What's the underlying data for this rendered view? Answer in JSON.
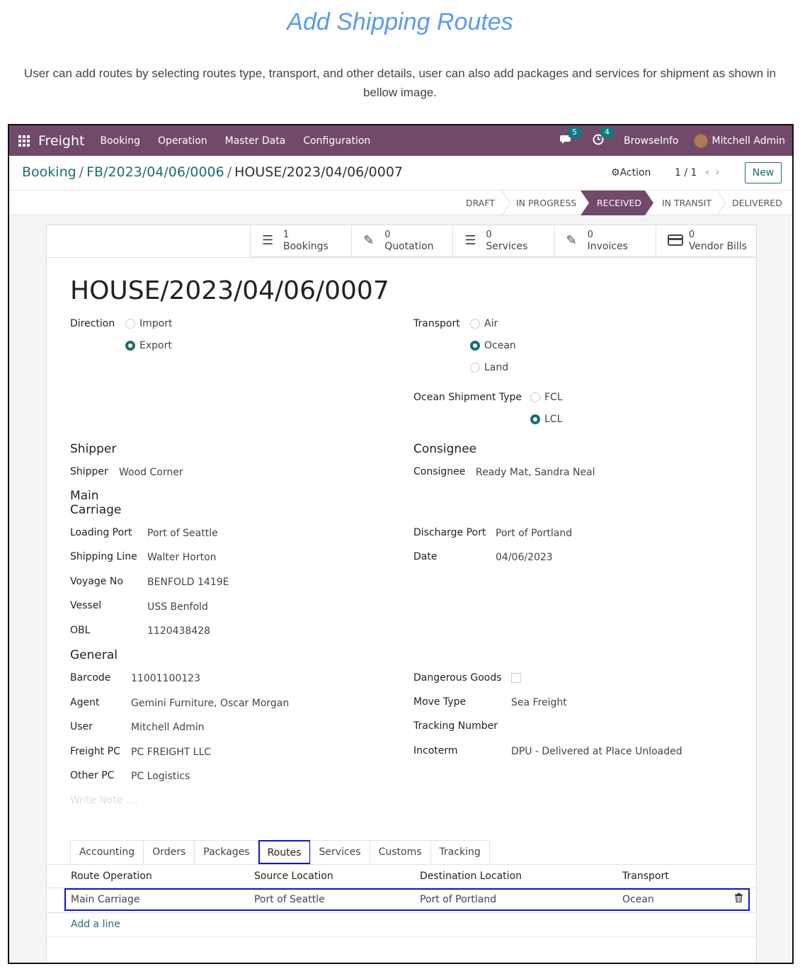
{
  "doc": {
    "title": "Add Shipping Routes",
    "intro": "User can add routes by selecting routes type, transport, and other details, user can also add packages and services for shipment as shown in bellow image."
  },
  "navbar": {
    "brand": "Freight",
    "menus": [
      "Booking",
      "Operation",
      "Master Data",
      "Configuration"
    ],
    "messages_count": "5",
    "activities_count": "4",
    "company": "BrowseInfo",
    "user": "Mitchell Admin"
  },
  "breadcrumb": [
    "Booking",
    "FB/2023/04/06/0006",
    "HOUSE/2023/04/06/0007"
  ],
  "control": {
    "action": "Action",
    "pager": "1 / 1",
    "new": "New"
  },
  "stages": [
    {
      "label": "DRAFT",
      "active": false
    },
    {
      "label": "IN PROGRESS",
      "active": false
    },
    {
      "label": "RECEIVED",
      "active": true
    },
    {
      "label": "IN TRANSIT",
      "active": false
    },
    {
      "label": "DELIVERED",
      "active": false
    }
  ],
  "smart_buttons": [
    {
      "value": "1",
      "label": "Bookings",
      "icon": "list-icon"
    },
    {
      "value": "0",
      "label": "Quotation",
      "icon": "edit-icon"
    },
    {
      "value": "0",
      "label": "Services",
      "icon": "list-icon"
    },
    {
      "value": "0",
      "label": "Invoices",
      "icon": "edit-icon"
    },
    {
      "value": "0",
      "label": "Vendor Bills",
      "icon": "credit-card-icon"
    }
  ],
  "record": {
    "title": "HOUSE/2023/04/06/0007",
    "direction_label": "Direction",
    "direction_options": [
      "Import",
      "Export"
    ],
    "direction_selected": "Export",
    "transport_label": "Transport",
    "transport_options": [
      "Air",
      "Ocean",
      "Land"
    ],
    "transport_selected": "Ocean",
    "ocean_type_label": "Ocean Shipment Type",
    "ocean_type_options": [
      "FCL",
      "LCL"
    ],
    "ocean_type_selected": "LCL",
    "shipper_section": "Shipper",
    "shipper_label": "Shipper",
    "shipper": "Wood Corner",
    "consignee_section": "Consignee",
    "consignee_label": "Consignee",
    "consignee": "Ready Mat, Sandra Neal",
    "main_carriage_section": "Main Carriage",
    "loading_port_label": "Loading Port",
    "loading_port": "Port of Seattle",
    "shipping_line_label": "Shipping Line",
    "shipping_line": "Walter Horton",
    "voyage_no_label": "Voyage No",
    "voyage_no": "BENFOLD 1419E",
    "vessel_label": "Vessel",
    "vessel": "USS Benfold",
    "obl_label": "OBL",
    "obl": "1120438428",
    "discharge_port_label": "Discharge Port",
    "discharge_port": "Port of Portland",
    "date_label": "Date",
    "date": "04/06/2023",
    "general_section": "General",
    "barcode_label": "Barcode",
    "barcode": "11001100123",
    "agent_label": "Agent",
    "agent": "Gemini Furniture, Oscar Morgan",
    "user_label": "User",
    "user": "Mitchell Admin",
    "freight_pc_label": "Freight PC",
    "freight_pc": "PC FREIGHT LLC",
    "other_pc_label": "Other PC",
    "other_pc": "PC Logistics",
    "dangerous_goods_label": "Dangerous Goods",
    "dangerous_goods": false,
    "move_type_label": "Move Type",
    "move_type": "Sea Freight",
    "tracking_number_label": "Tracking Number",
    "tracking_number": "",
    "incoterm_label": "Incoterm",
    "incoterm": "DPU - Delivered at Place Unloaded",
    "note_placeholder": "Write Note ...."
  },
  "tabs": [
    "Accounting",
    "Orders",
    "Packages",
    "Routes",
    "Services",
    "Customs",
    "Tracking"
  ],
  "active_tab": "Routes",
  "routes_table": {
    "columns": [
      "Route Operation",
      "Source Location",
      "Destination Location",
      "Transport"
    ],
    "rows": [
      {
        "operation": "Main Carriage",
        "source": "Port of Seattle",
        "destination": "Port of Portland",
        "transport": "Ocean"
      }
    ],
    "add_line": "Add a line"
  },
  "colors": {
    "navbar": "#71496a",
    "accent": "#1d6e70",
    "highlight": "#1216c4",
    "title": "#5b9bea"
  }
}
